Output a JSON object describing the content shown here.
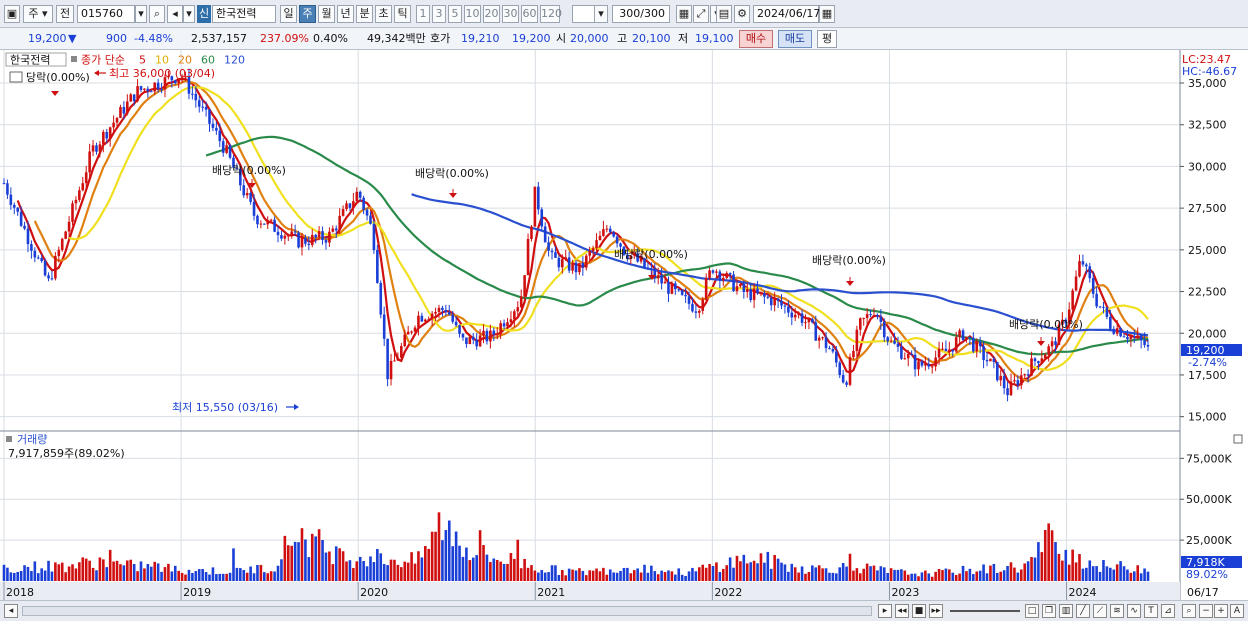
{
  "toolbar": {
    "menu_label": "주",
    "prefix_label": "전",
    "code_value": "015760",
    "new_badge": "신",
    "stock_name": "한국전력",
    "periods": [
      "일",
      "주",
      "월",
      "년",
      "분",
      "초",
      "틱"
    ],
    "active_period": "주",
    "intervals": [
      "1",
      "3",
      "5",
      "10",
      "20",
      "30",
      "60",
      "120"
    ],
    "count_value": "300",
    "count_total": "/300",
    "date_value": "2024/06/17"
  },
  "quote": {
    "price": "19,200",
    "change_arrow": "▼",
    "change": "900",
    "change_pct": "-4.48%",
    "volume": "2,537,157",
    "volume_ratio": "237.09%",
    "turnover": "0.40%",
    "amount": "49,342백만",
    "bid_label": "호가",
    "bid": "19,210",
    "ask": "19,200",
    "open_label": "시",
    "open": "20,000",
    "high_label": "고",
    "high": "20,100",
    "low_label": "저",
    "low": "19,100",
    "buy_label": "매수",
    "sell_label": "매도",
    "eval_label": "평"
  },
  "price_panel": {
    "title": "한국전력",
    "ma_label": "종가 단순",
    "ma_periods": [
      "5",
      "10",
      "20",
      "60",
      "120"
    ],
    "ma_colors": [
      "#d01010",
      "#e0b000",
      "#e08010",
      "#2a8a4a",
      "#2a50d0"
    ],
    "dividend_legend": "당락(0.00%)",
    "high_marker": "최고 36,000 (03/04)",
    "low_marker": "최저 15,550 (03/16)",
    "dividend_labels": [
      "배당락(0.00%)",
      "배당락(0.00%)",
      "배당락(0.00%)",
      "배당락(0.00%)",
      "배당락(0.00%)"
    ],
    "lc": "LC:23.47",
    "hc": "HC:-46.67",
    "current_price": "19,200",
    "current_pct": "-2.74%",
    "y_ticks": [
      "35,000",
      "32,500",
      "30,000",
      "27,500",
      "25,000",
      "22,500",
      "20,000",
      "17,500",
      "15,000"
    ]
  },
  "volume_panel": {
    "title": "거래량",
    "info": "7,917,859주(89.02%)",
    "y_ticks": [
      "75,000K",
      "50,000K",
      "25,000K"
    ],
    "current_value": "7,918K",
    "current_pct": "89.02%"
  },
  "x_axis": {
    "labels": [
      "2018",
      "2019",
      "2020",
      "2021",
      "2022",
      "2023",
      "2024"
    ],
    "end_label": "06/17"
  },
  "colors": {
    "up": "#d01010",
    "down": "#1a3fd6",
    "grid": "#d8dde4",
    "highlight": "#1a3fd6"
  },
  "chart_data": {
    "type": "candlestick",
    "period": "weekly",
    "x_range": [
      "2018-01",
      "2024-06-17"
    ],
    "ylim": [
      14500,
      36500
    ],
    "close_series": [
      {
        "x": "2018-01",
        "y": 29000
      },
      {
        "x": "2018-04",
        "y": 23000
      },
      {
        "x": "2018-07",
        "y": 31000
      },
      {
        "x": "2018-10",
        "y": 34500
      },
      {
        "x": "2019-01",
        "y": 35500
      },
      {
        "x": "2019-02",
        "y": 34000
      },
      {
        "x": "2019-04",
        "y": 31000
      },
      {
        "x": "2019-06",
        "y": 27000
      },
      {
        "x": "2019-09",
        "y": 25500
      },
      {
        "x": "2019-11",
        "y": 25800
      },
      {
        "x": "2020-01",
        "y": 28500
      },
      {
        "x": "2020-02",
        "y": 26000
      },
      {
        "x": "2020-03",
        "y": 17500
      },
      {
        "x": "2020-05",
        "y": 21000
      },
      {
        "x": "2020-07",
        "y": 21500
      },
      {
        "x": "2020-08",
        "y": 19500
      },
      {
        "x": "2020-10",
        "y": 19800
      },
      {
        "x": "2020-12",
        "y": 22000
      },
      {
        "x": "2021-01",
        "y": 28500
      },
      {
        "x": "2021-02",
        "y": 24500
      },
      {
        "x": "2021-04",
        "y": 23800
      },
      {
        "x": "2021-06",
        "y": 26500
      },
      {
        "x": "2021-07",
        "y": 25000
      },
      {
        "x": "2021-09",
        "y": 23500
      },
      {
        "x": "2021-11",
        "y": 22000
      },
      {
        "x": "2021-12",
        "y": 21500
      },
      {
        "x": "2022-01",
        "y": 24000
      },
      {
        "x": "2022-03",
        "y": 22500
      },
      {
        "x": "2022-05",
        "y": 22000
      },
      {
        "x": "2022-07",
        "y": 21000
      },
      {
        "x": "2022-09",
        "y": 19000
      },
      {
        "x": "2022-10",
        "y": 17000
      },
      {
        "x": "2022-11",
        "y": 20500
      },
      {
        "x": "2022-12",
        "y": 21500
      },
      {
        "x": "2023-01",
        "y": 19500
      },
      {
        "x": "2023-03",
        "y": 18000
      },
      {
        "x": "2023-05",
        "y": 19000
      },
      {
        "x": "2023-06",
        "y": 20000
      },
      {
        "x": "2023-08",
        "y": 18000
      },
      {
        "x": "2023-09",
        "y": 16500
      },
      {
        "x": "2023-11",
        "y": 18500
      },
      {
        "x": "2023-12",
        "y": 19200
      },
      {
        "x": "2024-01",
        "y": 21000
      },
      {
        "x": "2024-02",
        "y": 24500
      },
      {
        "x": "2024-03",
        "y": 22000
      },
      {
        "x": "2024-04",
        "y": 20500
      },
      {
        "x": "2024-05",
        "y": 20000
      },
      {
        "x": "2024-06-17",
        "y": 19200
      }
    ],
    "volume_k": [
      8000,
      8500,
      9000,
      10000,
      12000,
      9000,
      9500,
      7000,
      6500,
      6000,
      7000,
      8000,
      30000,
      22000,
      14000,
      15000,
      13000,
      12000,
      36000,
      20000,
      14000,
      12500,
      8000,
      6000,
      5500,
      7000,
      9000,
      6500,
      5000,
      8500,
      12000,
      14000,
      10000,
      7500,
      8000,
      8500,
      6500,
      5000,
      4500,
      6000,
      7000,
      8000,
      9000,
      27000,
      15000,
      9000,
      8500,
      7918
    ]
  }
}
